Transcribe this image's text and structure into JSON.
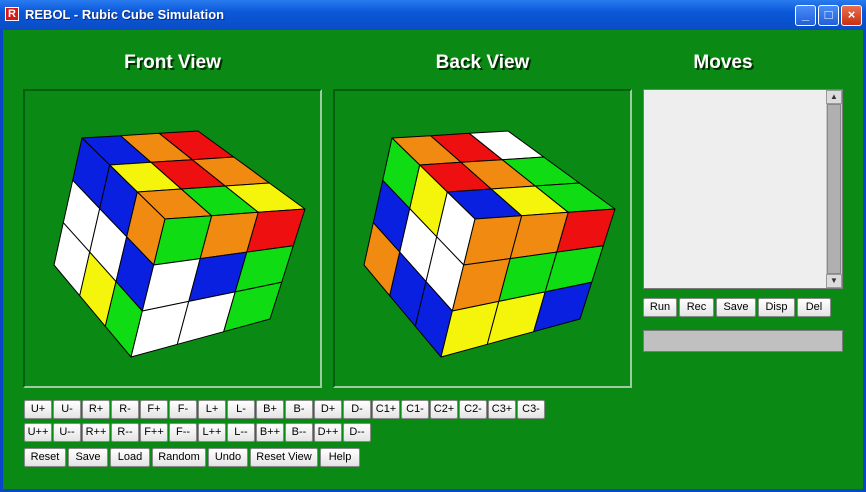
{
  "window": {
    "title": "REBOL - Rubic Cube Simulation",
    "icon_letter": "R"
  },
  "headings": {
    "front": "Front View",
    "back": "Back View",
    "moves": "Moves"
  },
  "colors": {
    "background": "#0a8a14",
    "cube_red": "#ee1010",
    "cube_orange": "#f08a10",
    "cube_blue": "#0a20e0",
    "cube_white": "#ffffff",
    "cube_yellow": "#f5f50c",
    "cube_green": "#10dc14"
  },
  "cube_faces": {
    "front": {
      "top": [
        [
          "blue",
          "orange",
          "red"
        ],
        [
          "yellow",
          "red",
          "orange"
        ],
        [
          "orange",
          "green",
          "yellow"
        ]
      ],
      "left": [
        [
          "blue",
          "blue",
          "orange"
        ],
        [
          "white",
          "white",
          "blue"
        ],
        [
          "white",
          "yellow",
          "green"
        ]
      ],
      "right": [
        [
          "green",
          "orange",
          "red"
        ],
        [
          "white",
          "blue",
          "green"
        ],
        [
          "white",
          "white",
          "green"
        ]
      ]
    },
    "back": {
      "top": [
        [
          "orange",
          "red",
          "white"
        ],
        [
          "red",
          "orange",
          "green"
        ],
        [
          "blue",
          "yellow",
          "green"
        ]
      ],
      "left": [
        [
          "green",
          "yellow",
          "white"
        ],
        [
          "blue",
          "white",
          "white"
        ],
        [
          "orange",
          "blue",
          "blue"
        ]
      ],
      "right": [
        [
          "orange",
          "orange",
          "red"
        ],
        [
          "orange",
          "green",
          "green"
        ],
        [
          "yellow",
          "yellow",
          "blue"
        ]
      ]
    }
  },
  "moves_buttons": [
    "Run",
    "Rec",
    "Save",
    "Disp",
    "Del"
  ],
  "move_row1": [
    "U+",
    "U-",
    "R+",
    "R-",
    "F+",
    "F-",
    "L+",
    "L-",
    "B+",
    "B-",
    "D+",
    "D-",
    "C1+",
    "C1-",
    "C2+",
    "C2-",
    "C3+",
    "C3-"
  ],
  "move_row2": [
    "U++",
    "U--",
    "R++",
    "R--",
    "F++",
    "F--",
    "L++",
    "L--",
    "B++",
    "B--",
    "D++",
    "D--"
  ],
  "action_row": [
    "Reset",
    "Save",
    "Load",
    "Random",
    "Undo",
    "Reset View",
    "Help"
  ]
}
